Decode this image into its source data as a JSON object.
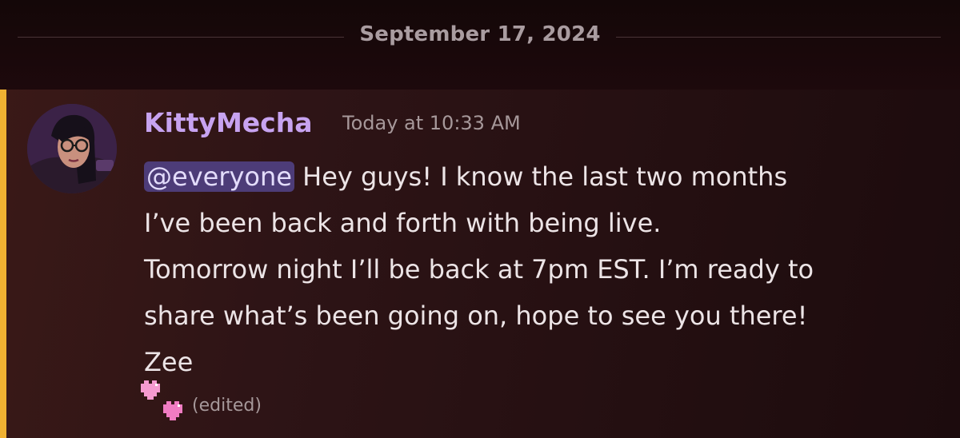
{
  "date_divider": {
    "label": "September 17, 2024"
  },
  "message": {
    "author": "KittyMecha",
    "timestamp": "Today at 10:33 AM",
    "mention": "@everyone",
    "lines": [
      " Hey guys! I know the last two months",
      "I’ve been back and forth with being live.",
      "Tomorrow night I’ll be back at 7pm EST. I’m ready to",
      "share what’s been going on, hope to see you there!",
      "Zee"
    ],
    "edited_label": "(edited)",
    "emoji": "pink-hearts-icon"
  },
  "colors": {
    "author": "#c7a3f0",
    "mention_bg": "#4d3c78",
    "mention_bar": "#f0b132",
    "text": "#ece4e6",
    "muted": "#a6989a"
  }
}
